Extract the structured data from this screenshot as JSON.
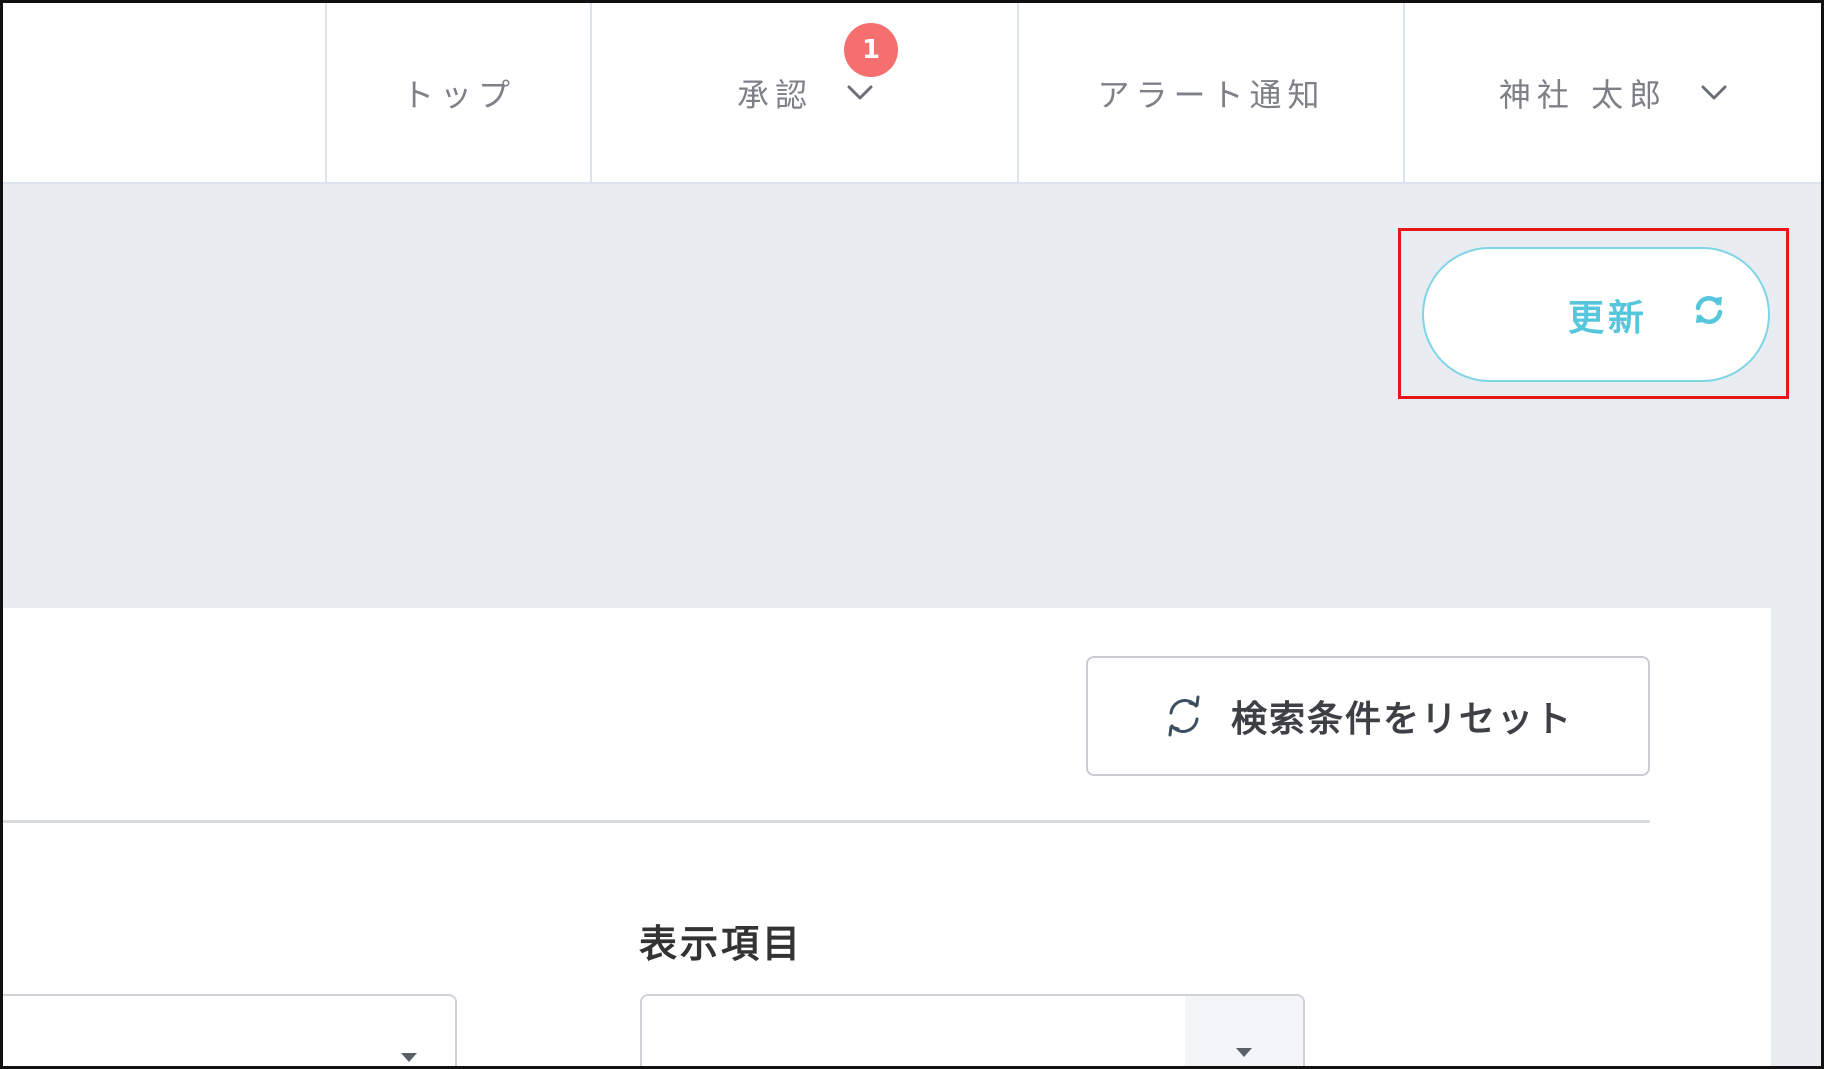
{
  "header": {
    "nav": {
      "top": "トップ",
      "approval": "承認",
      "approval_badge": "1",
      "alert": "アラート通知",
      "user": "神社 太郎"
    }
  },
  "toolbar": {
    "refresh_label": "更新"
  },
  "filters": {
    "reset_label": "検索条件をリセット",
    "display_items_label": "表示項目"
  },
  "colors": {
    "accent": "#55c6db",
    "badge": "#f56f6f",
    "highlight": "#e8151b"
  }
}
